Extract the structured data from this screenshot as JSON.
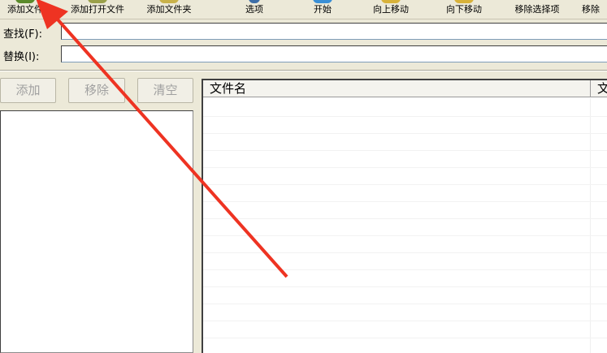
{
  "toolbar": {
    "buttons": [
      {
        "label": "添加文件",
        "icon": "add-file-icon",
        "color": "#5a8a2a"
      },
      {
        "label": "添加打开文件",
        "icon": "add-open-file-icon",
        "color": "#9aa04a"
      },
      {
        "label": "添加文件夹",
        "icon": "add-folder-icon",
        "color": "#c9b24a"
      },
      {
        "label": "选项",
        "icon": "gear-icon",
        "color": "#3d6ea8"
      },
      {
        "label": "开始",
        "icon": "start-icon",
        "color": "#3a8fd6"
      },
      {
        "label": "向上移动",
        "icon": "move-up-icon",
        "color": "#d8b23a"
      },
      {
        "label": "向下移动",
        "icon": "move-down-icon",
        "color": "#d8b23a"
      },
      {
        "label": "移除选择项",
        "icon": "remove-selected-icon",
        "color": "#9a9a9a"
      },
      {
        "label": "移除",
        "icon": "remove-icon",
        "color": "#9a9a9a"
      }
    ]
  },
  "find": {
    "label": "查找(F):",
    "value": ""
  },
  "replace": {
    "label": "替换(I):",
    "value": ""
  },
  "left_buttons": {
    "add": "添加",
    "remove": "移除",
    "clear": "清空"
  },
  "table": {
    "columns": [
      "文件名",
      "文"
    ]
  },
  "annotation": {
    "arrow_color": "#ee3322"
  }
}
